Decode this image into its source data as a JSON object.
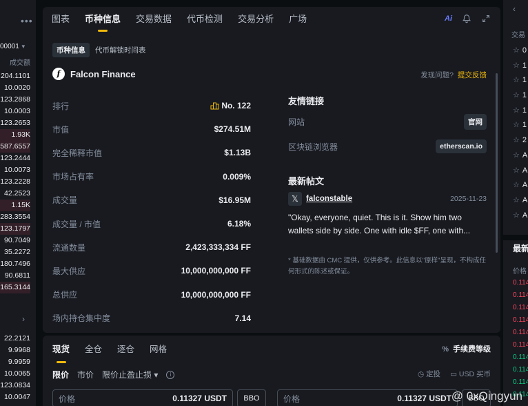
{
  "orderbook": {
    "precision": "00001",
    "col_header": "成交额",
    "rows": [
      "204.1101",
      "10.0020",
      "123.2868",
      "10.0003",
      "123.2653",
      "1.93K",
      "587.6557",
      "123.2444",
      "10.0073",
      "123.2228",
      "42.2523",
      "1.15K",
      "283.3554",
      "123.1797",
      "90.7049",
      "35.2272",
      "180.7496",
      "90.6811",
      "165.3144"
    ],
    "rows_lower": [
      "22.2121",
      "9.9968",
      "9.9959",
      "10.0065",
      "123.0834",
      "10.0047"
    ]
  },
  "tabs": [
    "图表",
    "币种信息",
    "交易数据",
    "代币检测",
    "交易分析",
    "广场"
  ],
  "active_tab": "币种信息",
  "ai_label": "Ai",
  "subtabs": [
    "币种信息",
    "代币解锁时间表"
  ],
  "token": {
    "logo": "f",
    "name": "Falcon Finance"
  },
  "issue": {
    "text": "发现问题?",
    "feedback": "提交反馈"
  },
  "stats": [
    {
      "k": "排行",
      "v": "No. 122"
    },
    {
      "k": "市值",
      "v": "$274.51M"
    },
    {
      "k": "完全稀释市值",
      "v": "$1.13B"
    },
    {
      "k": "市场占有率",
      "v": "0.009%"
    },
    {
      "k": "成交量",
      "v": "$16.95M"
    },
    {
      "k": "成交量 / 市值",
      "v": "6.18%"
    },
    {
      "k": "流通数量",
      "v": "2,423,333,334 FF"
    },
    {
      "k": "最大供应",
      "v": "10,000,000,000 FF"
    },
    {
      "k": "总供应",
      "v": "10,000,000,000 FF"
    },
    {
      "k": "场内持仓集中度",
      "v": "7.14"
    }
  ],
  "links": {
    "title": "友情链接",
    "items": [
      {
        "k": "网站",
        "v": "官网"
      },
      {
        "k": "区块链浏览器",
        "v": "etherscan.io"
      }
    ]
  },
  "posts": {
    "title": "最新帖文",
    "author": "falconstable",
    "date": "2025-11-23",
    "text": "\"Okay, everyone, quiet. This is it. Show him two wallets side by side. One with idle $FF, one with..."
  },
  "disclaimer": "* 基础数据由 CMC 提供，仅供参考。此信息以\"原样\"呈现，不构成任何形式的陈述或保证。",
  "rside": {
    "header": "交易",
    "items": [
      "0",
      "1",
      "1",
      "1",
      "1",
      "1",
      "2",
      "A",
      "A",
      "A",
      "A",
      "A"
    ],
    "latest_title": "最新",
    "price_header": "价格",
    "prices": [
      {
        "v": "0.114",
        "c": "#f6465d"
      },
      {
        "v": "0.114",
        "c": "#f6465d"
      },
      {
        "v": "0.114",
        "c": "#f6465d"
      },
      {
        "v": "0.114",
        "c": "#f6465d"
      },
      {
        "v": "0.114",
        "c": "#f6465d"
      },
      {
        "v": "0.114",
        "c": "#f6465d"
      },
      {
        "v": "0.114",
        "c": "#0ecb81"
      },
      {
        "v": "0.114",
        "c": "#0ecb81"
      },
      {
        "v": "0.114",
        "c": "#0ecb81"
      },
      {
        "v": "0.114",
        "c": "#0ecb81"
      }
    ]
  },
  "trade": {
    "tabs": [
      "现货",
      "全仓",
      "逐仓",
      "网格"
    ],
    "fee": "手续费等级",
    "order_types": [
      "限价",
      "市价",
      "限价止盈止损"
    ],
    "right_opts": [
      "定投",
      "USD 买币"
    ],
    "inputs": [
      {
        "label": "价格",
        "value": "0.11327",
        "unit": "USDT"
      },
      {
        "label": "价格",
        "value": "0.11327",
        "unit": "USDT"
      }
    ],
    "bbo": "BBO"
  },
  "watermark": "@ 0xQingyun"
}
